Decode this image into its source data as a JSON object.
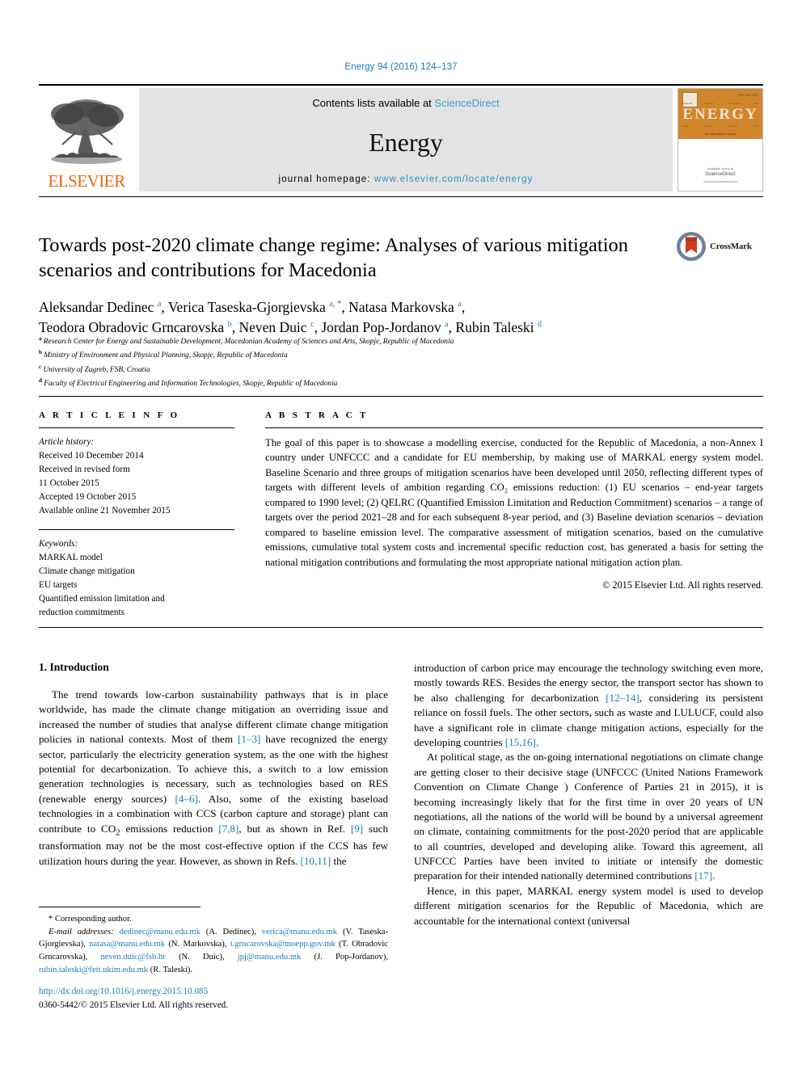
{
  "running_head": "Energy 94 (2016) 124–137",
  "masthead": {
    "publisher": "ELSEVIER",
    "contents_prefix": "Contents lists available at ",
    "contents_link": "ScienceDirect",
    "journal_name": "Energy",
    "homepage_prefix": "journal homepage: ",
    "homepage_url": "www.elsevier.com/locate/energy",
    "cover": {
      "title": "ENERGY",
      "subtitle": "The International Journal",
      "footer_line1": "Available online at",
      "footer_line2": "ScienceDirect",
      "footer_line3": "www.sciencedirect.com"
    }
  },
  "article": {
    "title": "Towards post-2020 climate change regime: Analyses of various mitigation scenarios and contributions for Macedonia",
    "authors": [
      {
        "name": "Aleksandar Dedinec",
        "marks": "a"
      },
      {
        "name": "Verica Taseska-Gjorgievska",
        "marks": "a, *"
      },
      {
        "name": "Natasa Markovska",
        "marks": "a"
      },
      {
        "name": "Teodora Obradovic Grncarovska",
        "marks": "b"
      },
      {
        "name": "Neven Duic",
        "marks": "c"
      },
      {
        "name": "Jordan Pop-Jordanov",
        "marks": "a"
      },
      {
        "name": "Rubin Taleski",
        "marks": "d"
      }
    ],
    "affiliations": [
      {
        "mark": "a",
        "text": "Research Center for Energy and Sustainable Development, Macedonian Academy of Sciences and Arts, Skopje, Republic of Macedonia"
      },
      {
        "mark": "b",
        "text": "Ministry of Environment and Physical Planning, Skopje, Republic of Macedonia"
      },
      {
        "mark": "c",
        "text": "University of Zagreb, FSB, Croatia"
      },
      {
        "mark": "d",
        "text": "Faculty of Electrical Engineering and Information Technologies, Skopje, Republic of Macedonia"
      }
    ],
    "crossmark_label": "CrossMark"
  },
  "article_info": {
    "heading": "A R T I C L E  I N F O",
    "history_label": "Article history:",
    "history": [
      "Received 10 December 2014",
      "Received in revised form",
      "11 October 2015",
      "Accepted 19 October 2015",
      "Available online 21 November 2015"
    ],
    "keywords_label": "Keywords:",
    "keywords": [
      "MARKAL model",
      "Climate change mitigation",
      "EU targets",
      "Quantified emission limitation and",
      "reduction commitments"
    ]
  },
  "abstract": {
    "heading": "A B S T R A C T",
    "text": "The goal of this paper is to showcase a modelling exercise, conducted for the Republic of Macedonia, a non-Annex I country under UNFCCC and a candidate for EU membership, by making use of MARKAL energy system model. Baseline Scenario and three groups of mitigation scenarios have been developed until 2050, reflecting different types of targets with different levels of ambition regarding CO₂ emissions reduction: (1) EU scenarios – end-year targets compared to 1990 level; (2) QELRC (Quantified Emission Limitation and Reduction Commitment) scenarios – a range of targets over the period 2021–28 and for each subsequent 8-year period, and (3) Baseline deviation scenarios – deviation compared to baseline emission level. The comparative assessment of mitigation scenarios, based on the cumulative emissions, cumulative total system costs and incremental specific reduction cost, has generated a basis for setting the national mitigation contributions and formulating the most appropriate national mitigation action plan.",
    "copyright": "© 2015 Elsevier Ltd. All rights reserved."
  },
  "body": {
    "section_heading": "1. Introduction",
    "left_paragraph": "The trend towards low-carbon sustainability pathways that is in place worldwide, has made the climate change mitigation an overriding issue and increased the number of studies that analyse different climate change mitigation policies in national contexts. Most of them [1–3] have recognized the energy sector, particularly the electricity generation system, as the one with the highest potential for decarbonization. To achieve this, a switch to a low emission generation technologies is necessary, such as technologies based on RES (renewable energy sources) [4–6]. Also, some of the existing baseload technologies in a combination with CCS (carbon capture and storage) plant can contribute to CO₂ emissions reduction [7,8], but as shown in Ref. [9] such transformation may not be the most cost-effective option if the CCS has few utilization hours during the year. However, as shown in Refs. [10,11] the",
    "right_paragraph_1": "introduction of carbon price may encourage the technology switching even more, mostly towards RES. Besides the energy sector, the transport sector has shown to be also challenging for decarbonization [12–14], considering its persistent reliance on fossil fuels. The other sectors, such as waste and LULUCF, could also have a significant role in climate change mitigation actions, especially for the developing countries [15,16].",
    "right_paragraph_2": "At political stage, as the on-going international negotiations on climate change are getting closer to their decisive stage (UNFCCC (United Nations Framework Convention on Climate Change ) Conference of Parties 21 in 2015), it is becoming increasingly likely that for the first time in over 20 years of UN negotiations, all the nations of the world will be bound by a universal agreement on climate, containing commitments for the post-2020 period that are applicable to all countries, developed and developing alike. Toward this agreement, all UNFCCC Parties have been invited to initiate or intensify the domestic preparation for their intended nationally determined contributions [17].",
    "right_paragraph_3": "Hence, in this paper, MARKAL energy system model is used to develop different mitigation scenarios for the Republic of Macedonia, which are accountable for the international context (universal"
  },
  "footnote": {
    "corresponding": "* Corresponding author.",
    "email_label": "E-mail addresses:",
    "emails": [
      {
        "address": "dedinec@manu.edu.mk",
        "owner": "(A. Dedinec)"
      },
      {
        "address": "verica@manu.edu.mk",
        "owner": "(V. Taseska-Gjorgievska)"
      },
      {
        "address": "natasa@manu.edu.mk",
        "owner": "(N. Markovska)"
      },
      {
        "address": "t.grncarovska@moepp.gov.mk",
        "owner": "(T. Obradovic Grncarovska)"
      },
      {
        "address": "neven.duic@fsb.hr",
        "owner": "(N. Duic)"
      },
      {
        "address": "jpj@manu.edu.mk",
        "owner": "(J. Pop-Jordanov)"
      },
      {
        "address": "rubin.taleski@feit.ukim.edu.mk",
        "owner": "(R. Taleski)"
      }
    ]
  },
  "imprint": {
    "doi": "http://dx.doi.org/10.1016/j.energy.2015.10.085",
    "issn_line": "0360-5442/© 2015 Elsevier Ltd. All rights reserved."
  },
  "colors": {
    "link": "#1a7bb9",
    "elsevier_orange": "#ec6608",
    "band_gray": "#e3e3e3",
    "cover_orange": "#d2862c"
  }
}
